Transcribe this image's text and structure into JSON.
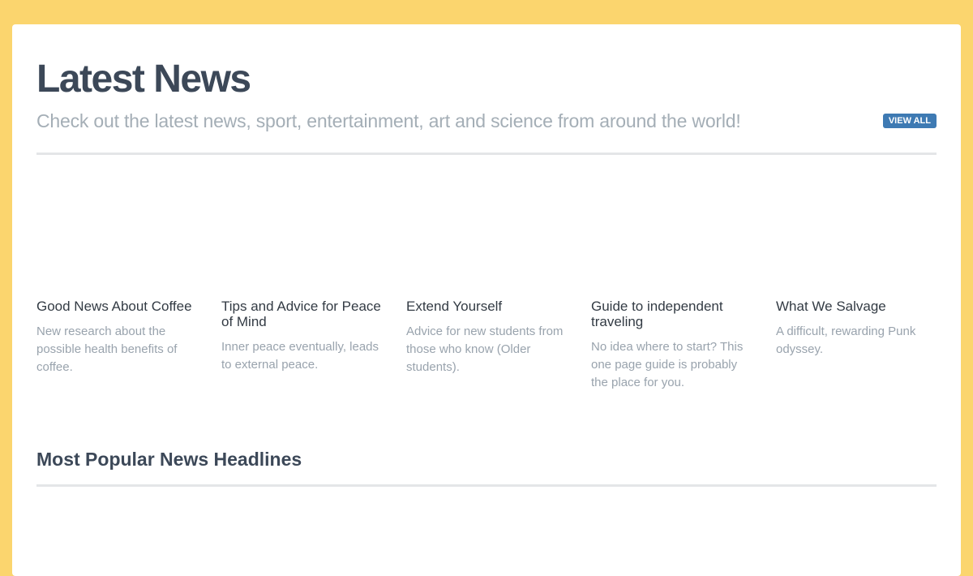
{
  "header": {
    "title": "Latest News",
    "subtitle": "Check out the latest news, sport, entertainment, art and science from around the world!",
    "view_all_label": "VIEW ALL"
  },
  "news": [
    {
      "title": "Good News About Coffee",
      "description": "New research about the possible health benefits of coffee."
    },
    {
      "title": "Tips and Advice for Peace of Mind",
      "description": "Inner peace eventually, leads to external peace."
    },
    {
      "title": "Extend Yourself",
      "description": "Advice for new students from those who know (Older students)."
    },
    {
      "title": "Guide to independent traveling",
      "description": "No idea where to start? This one page guide is probably the place for you."
    },
    {
      "title": "What We Salvage",
      "description": "A difficult, rewarding Punk odyssey."
    }
  ],
  "popular": {
    "title": "Most Popular News Headlines"
  },
  "colors": {
    "page_background": "#fbd56e",
    "heading": "#3c4858",
    "muted_text": "#99a3ad",
    "accent_button": "#3e7ab3"
  }
}
